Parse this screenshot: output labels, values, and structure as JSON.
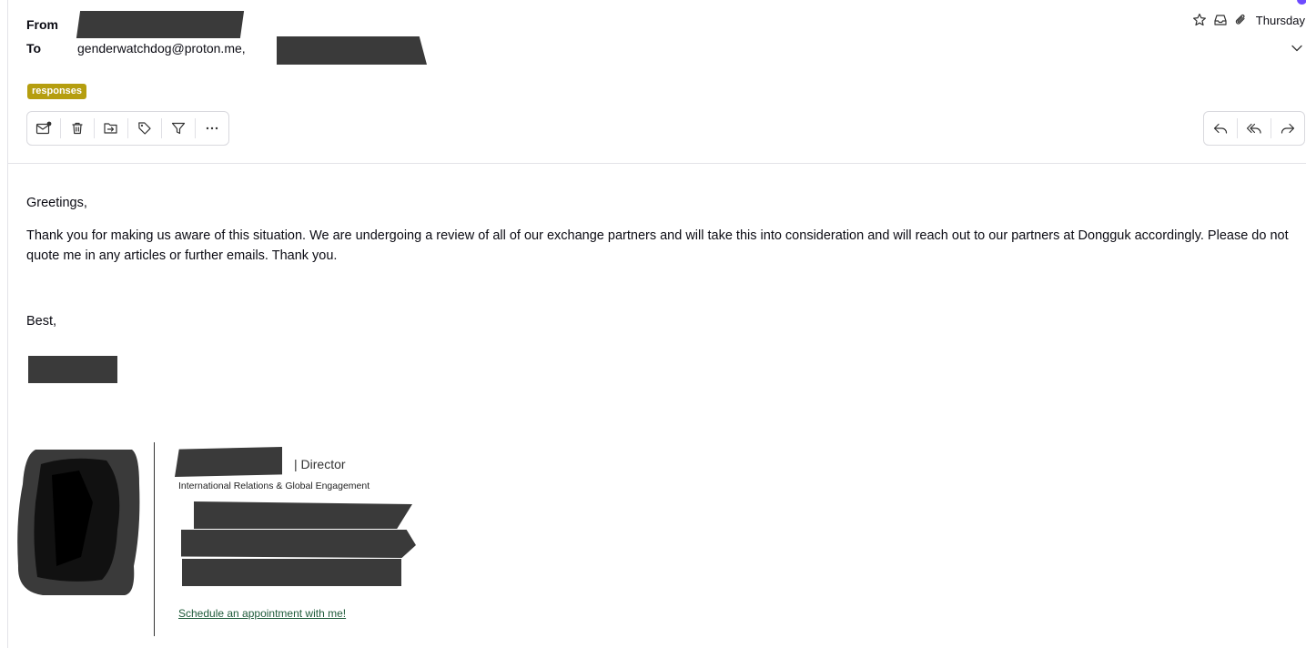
{
  "header": {
    "from_label": "From",
    "to_label": "To",
    "to_address": "genderwatchdog@proton.me,",
    "date": "Thursday",
    "icons": [
      "star-icon",
      "inbox-icon",
      "paperclip-icon",
      "chevron-down-icon"
    ]
  },
  "labels": [
    "responses"
  ],
  "toolbar": {
    "left_icons": [
      "mark-unread-icon",
      "trash-icon",
      "move-to-folder-icon",
      "tag-icon",
      "filter-icon",
      "more-icon"
    ],
    "right_icons": [
      "reply-icon",
      "reply-all-icon",
      "forward-icon"
    ]
  },
  "body": {
    "greeting": "Greetings,",
    "paragraph": "Thank you for making us aware of this situation. We are undergoing a review of all of our exchange partners and will take this into consideration and will reach out to our partners at Dongguk accordingly. Please do not quote me in any articles or further emails. Thank you.",
    "closing": "Best,"
  },
  "signature": {
    "role": "| Director",
    "department": "International Relations & Global Engagement",
    "link_text": "Schedule an appointment with me!"
  },
  "colors": {
    "label_badge": "#b59e0f",
    "accent": "#6d4aff",
    "link": "#1f5b3a",
    "redaction": "#3a3a3a"
  }
}
